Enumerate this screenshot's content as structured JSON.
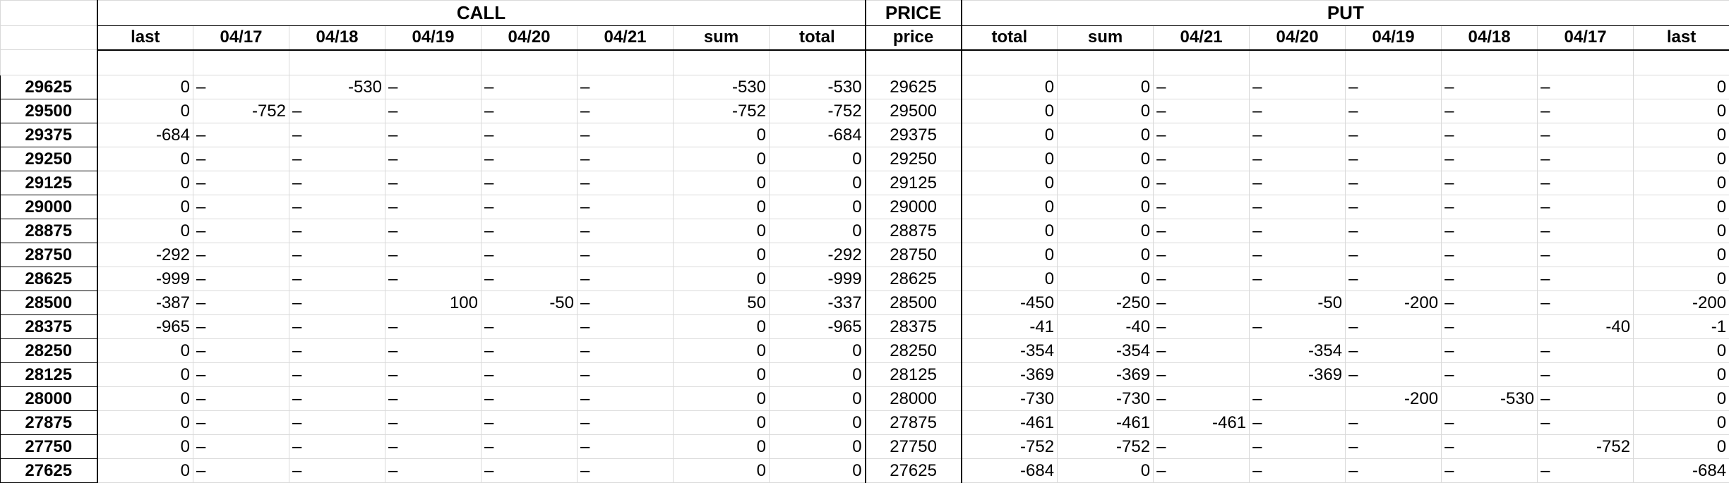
{
  "groups": {
    "call": "CALL",
    "price": "PRICE",
    "put": "PUT"
  },
  "columns": [
    "last",
    "04/17",
    "04/18",
    "04/19",
    "04/20",
    "04/21",
    "sum",
    "total",
    "price",
    "total",
    "sum",
    "04/21",
    "04/20",
    "04/19",
    "04/18",
    "04/17",
    "last"
  ],
  "rows": [
    {
      "label": "29625",
      "cells": [
        "0",
        "–",
        "-530",
        "–",
        "–",
        "–",
        "-530",
        "-530",
        "29625",
        "0",
        "0",
        "–",
        "–",
        "–",
        "–",
        "–",
        "0"
      ]
    },
    {
      "label": "29500",
      "cells": [
        "0",
        "-752",
        "–",
        "–",
        "–",
        "–",
        "-752",
        "-752",
        "29500",
        "0",
        "0",
        "–",
        "–",
        "–",
        "–",
        "–",
        "0"
      ]
    },
    {
      "label": "29375",
      "cells": [
        "-684",
        "–",
        "–",
        "–",
        "–",
        "–",
        "0",
        "-684",
        "29375",
        "0",
        "0",
        "–",
        "–",
        "–",
        "–",
        "–",
        "0"
      ]
    },
    {
      "label": "29250",
      "cells": [
        "0",
        "–",
        "–",
        "–",
        "–",
        "–",
        "0",
        "0",
        "29250",
        "0",
        "0",
        "–",
        "–",
        "–",
        "–",
        "–",
        "0"
      ]
    },
    {
      "label": "29125",
      "cells": [
        "0",
        "–",
        "–",
        "–",
        "–",
        "–",
        "0",
        "0",
        "29125",
        "0",
        "0",
        "–",
        "–",
        "–",
        "–",
        "–",
        "0"
      ]
    },
    {
      "label": "29000",
      "cells": [
        "0",
        "–",
        "–",
        "–",
        "–",
        "–",
        "0",
        "0",
        "29000",
        "0",
        "0",
        "–",
        "–",
        "–",
        "–",
        "–",
        "0"
      ]
    },
    {
      "label": "28875",
      "cells": [
        "0",
        "–",
        "–",
        "–",
        "–",
        "–",
        "0",
        "0",
        "28875",
        "0",
        "0",
        "–",
        "–",
        "–",
        "–",
        "–",
        "0"
      ]
    },
    {
      "label": "28750",
      "cells": [
        "-292",
        "–",
        "–",
        "–",
        "–",
        "–",
        "0",
        "-292",
        "28750",
        "0",
        "0",
        "–",
        "–",
        "–",
        "–",
        "–",
        "0"
      ]
    },
    {
      "label": "28625",
      "cells": [
        "-999",
        "–",
        "–",
        "–",
        "–",
        "–",
        "0",
        "-999",
        "28625",
        "0",
        "0",
        "–",
        "–",
        "–",
        "–",
        "–",
        "0"
      ]
    },
    {
      "label": "28500",
      "cells": [
        "-387",
        "–",
        "–",
        "100",
        "-50",
        "–",
        "50",
        "-337",
        "28500",
        "-450",
        "-250",
        "–",
        "-50",
        "-200",
        "–",
        "–",
        "-200"
      ]
    },
    {
      "label": "28375",
      "cells": [
        "-965",
        "–",
        "–",
        "–",
        "–",
        "–",
        "0",
        "-965",
        "28375",
        "-41",
        "-40",
        "–",
        "–",
        "–",
        "–",
        "-40",
        "-1"
      ]
    },
    {
      "label": "28250",
      "cells": [
        "0",
        "–",
        "–",
        "–",
        "–",
        "–",
        "0",
        "0",
        "28250",
        "-354",
        "-354",
        "–",
        "-354",
        "–",
        "–",
        "–",
        "0"
      ]
    },
    {
      "label": "28125",
      "cells": [
        "0",
        "–",
        "–",
        "–",
        "–",
        "–",
        "0",
        "0",
        "28125",
        "-369",
        "-369",
        "–",
        "-369",
        "–",
        "–",
        "–",
        "0"
      ]
    },
    {
      "label": "28000",
      "cells": [
        "0",
        "–",
        "–",
        "–",
        "–",
        "–",
        "0",
        "0",
        "28000",
        "-730",
        "-730",
        "–",
        "–",
        "-200",
        "-530",
        "–",
        "0"
      ]
    },
    {
      "label": "27875",
      "cells": [
        "0",
        "–",
        "–",
        "–",
        "–",
        "–",
        "0",
        "0",
        "27875",
        "-461",
        "-461",
        "-461",
        "–",
        "–",
        "–",
        "–",
        "0"
      ]
    },
    {
      "label": "27750",
      "cells": [
        "0",
        "–",
        "–",
        "–",
        "–",
        "–",
        "0",
        "0",
        "27750",
        "-752",
        "-752",
        "–",
        "–",
        "–",
        "–",
        "-752",
        "0"
      ]
    },
    {
      "label": "27625",
      "cells": [
        "0",
        "–",
        "–",
        "–",
        "–",
        "–",
        "0",
        "0",
        "27625",
        "-684",
        "0",
        "–",
        "–",
        "–",
        "–",
        "–",
        "-684"
      ]
    }
  ]
}
